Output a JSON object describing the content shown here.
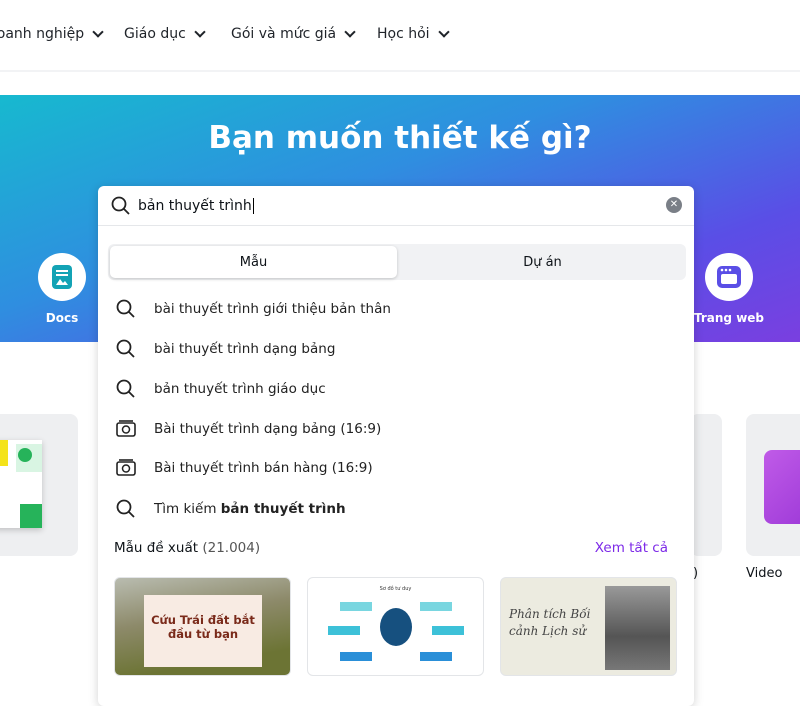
{
  "nav": {
    "items": [
      "Doanh nghiệp",
      "Giáo dục",
      "Gói và mức giá",
      "Học hỏi"
    ]
  },
  "banner": {
    "title": "Bạn muốn thiết kế gì?",
    "categories": [
      {
        "label": "Docs",
        "icon": "docs-icon"
      },
      {
        "label": "Trang web",
        "icon": "website-icon"
      }
    ]
  },
  "search": {
    "value": "bản thuyết trình",
    "tabs": [
      {
        "label": "Mẫu",
        "active": true
      },
      {
        "label": "Dự án",
        "active": false
      }
    ],
    "suggestions": [
      {
        "icon": "search-icon",
        "text": "bài thuyết trình giới thiệu bản thân"
      },
      {
        "icon": "search-icon",
        "text": "bài thuyết trình dạng bảng"
      },
      {
        "icon": "search-icon",
        "text": "bản thuyết trình giáo dục"
      },
      {
        "icon": "presentation-icon",
        "text": "Bài thuyết trình dạng bảng (16:9)"
      },
      {
        "icon": "presentation-icon",
        "text": "Bài thuyết trình bán hàng (16:9)"
      }
    ],
    "search_all": {
      "prefix": "Tìm kiếm ",
      "query": "bản thuyết trình"
    },
    "suggested": {
      "label": "Mẫu đề xuất",
      "count": "(21.004)",
      "see_all": "Xem tất cả",
      "templates": [
        {
          "title": "Cứu Trái đất bắt đầu từ bạn"
        },
        {
          "title": "Sơ đồ tư duy"
        },
        {
          "title": "Phân tích Bối cảnh Lịch sử"
        }
      ]
    }
  },
  "background_cards": {
    "partial_label": ")",
    "video_label": "Video"
  },
  "colors": {
    "accent": "#7d2ae8",
    "docs": "#13a3b5",
    "web": "#5a4ee6"
  }
}
